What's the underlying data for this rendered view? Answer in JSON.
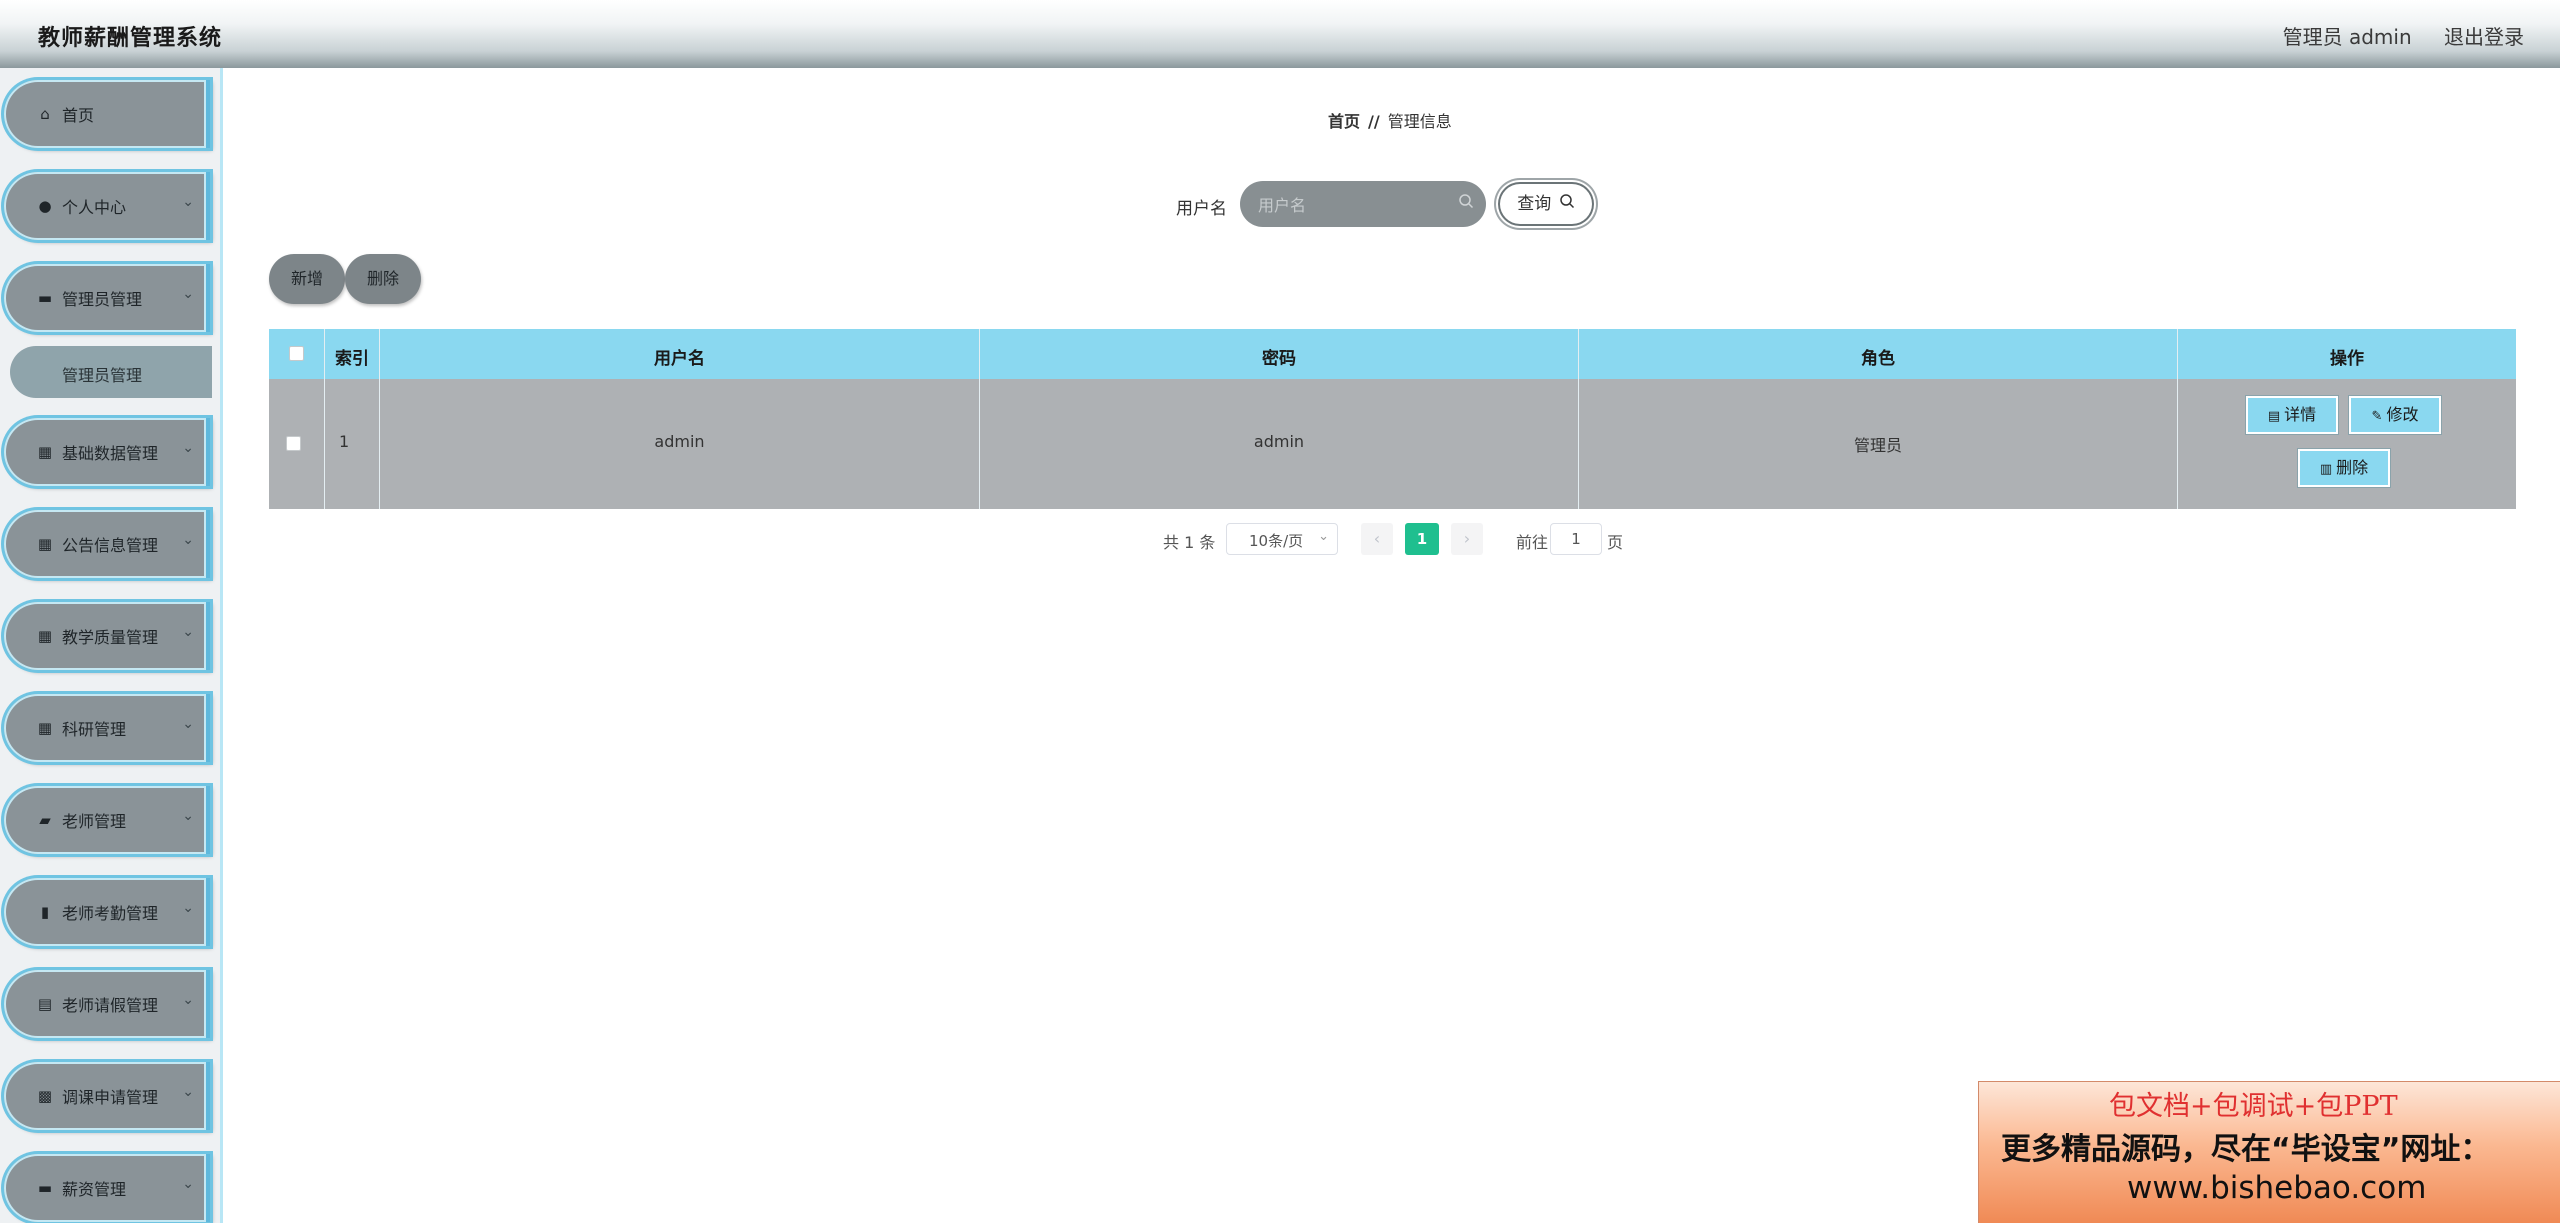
{
  "header": {
    "title": "教师薪酬管理系统",
    "user_label": "管理员 admin",
    "logout_label": "退出登录"
  },
  "sidebar": {
    "items": [
      {
        "label": "首页",
        "icon": "home-icon",
        "glyph": "⌂",
        "chevron": ""
      },
      {
        "label": "个人中心",
        "icon": "person-icon",
        "glyph": "●",
        "chevron": "⌄"
      },
      {
        "label": "管理员管理",
        "icon": "chat-icon",
        "glyph": "▬",
        "chevron": "⌄"
      },
      {
        "label": "基础数据管理",
        "icon": "grid-icon",
        "glyph": "▦",
        "chevron": "⌄"
      },
      {
        "label": "公告信息管理",
        "icon": "grid-icon",
        "glyph": "▦",
        "chevron": "⌄"
      },
      {
        "label": "教学质量管理",
        "icon": "grid-icon",
        "glyph": "▦",
        "chevron": "⌄"
      },
      {
        "label": "科研管理",
        "icon": "grid-icon",
        "glyph": "▦",
        "chevron": "⌄"
      },
      {
        "label": "老师管理",
        "icon": "briefcase-icon",
        "glyph": "▰",
        "chevron": "⌄"
      },
      {
        "label": "老师考勤管理",
        "icon": "bar-chart-icon",
        "glyph": "▮",
        "chevron": "⌄"
      },
      {
        "label": "老师请假管理",
        "icon": "clipboard-icon",
        "glyph": "▤",
        "chevron": "⌄"
      },
      {
        "label": "调课申请管理",
        "icon": "apps-icon",
        "glyph": "▩",
        "chevron": "⌄"
      },
      {
        "label": "薪资管理",
        "icon": "wallet-icon",
        "glyph": "▬",
        "chevron": "⌄"
      }
    ],
    "sub_item": {
      "label": "管理员管理"
    }
  },
  "breadcrumb": {
    "home": "首页",
    "separator": "//",
    "current": "管理信息"
  },
  "search": {
    "label": "用户名",
    "placeholder": "用户名",
    "button_label": "查询"
  },
  "toolbar": {
    "add_label": "新增",
    "delete_label": "删除"
  },
  "table": {
    "headers": [
      "索引",
      "用户名",
      "密码",
      "角色",
      "操作"
    ],
    "rows": [
      {
        "index": "1",
        "username": "admin",
        "password": "admin",
        "role": "管理员"
      }
    ],
    "actions": {
      "detail": "详情",
      "edit": "修改",
      "delete": "删除"
    }
  },
  "pagination": {
    "total": "共 1 条",
    "page_size": "10条/页",
    "current_page": "1",
    "goto_label": "前往",
    "goto_value": "1",
    "page_suffix": "页"
  },
  "watermark": {
    "line1": "包文档+包调试+包PPT",
    "line2": "更多精品源码，尽在“毕设宝”网址：",
    "line3": "www.bishebao.com"
  },
  "colors": {
    "header_gradient_bottom": "#8b989c",
    "menu_bg": "#8a9398",
    "menu_border": "#6fc4e2",
    "table_header": "#8ad8f0",
    "table_row": "#aeb1b4",
    "page_active": "#1fbf8f"
  }
}
